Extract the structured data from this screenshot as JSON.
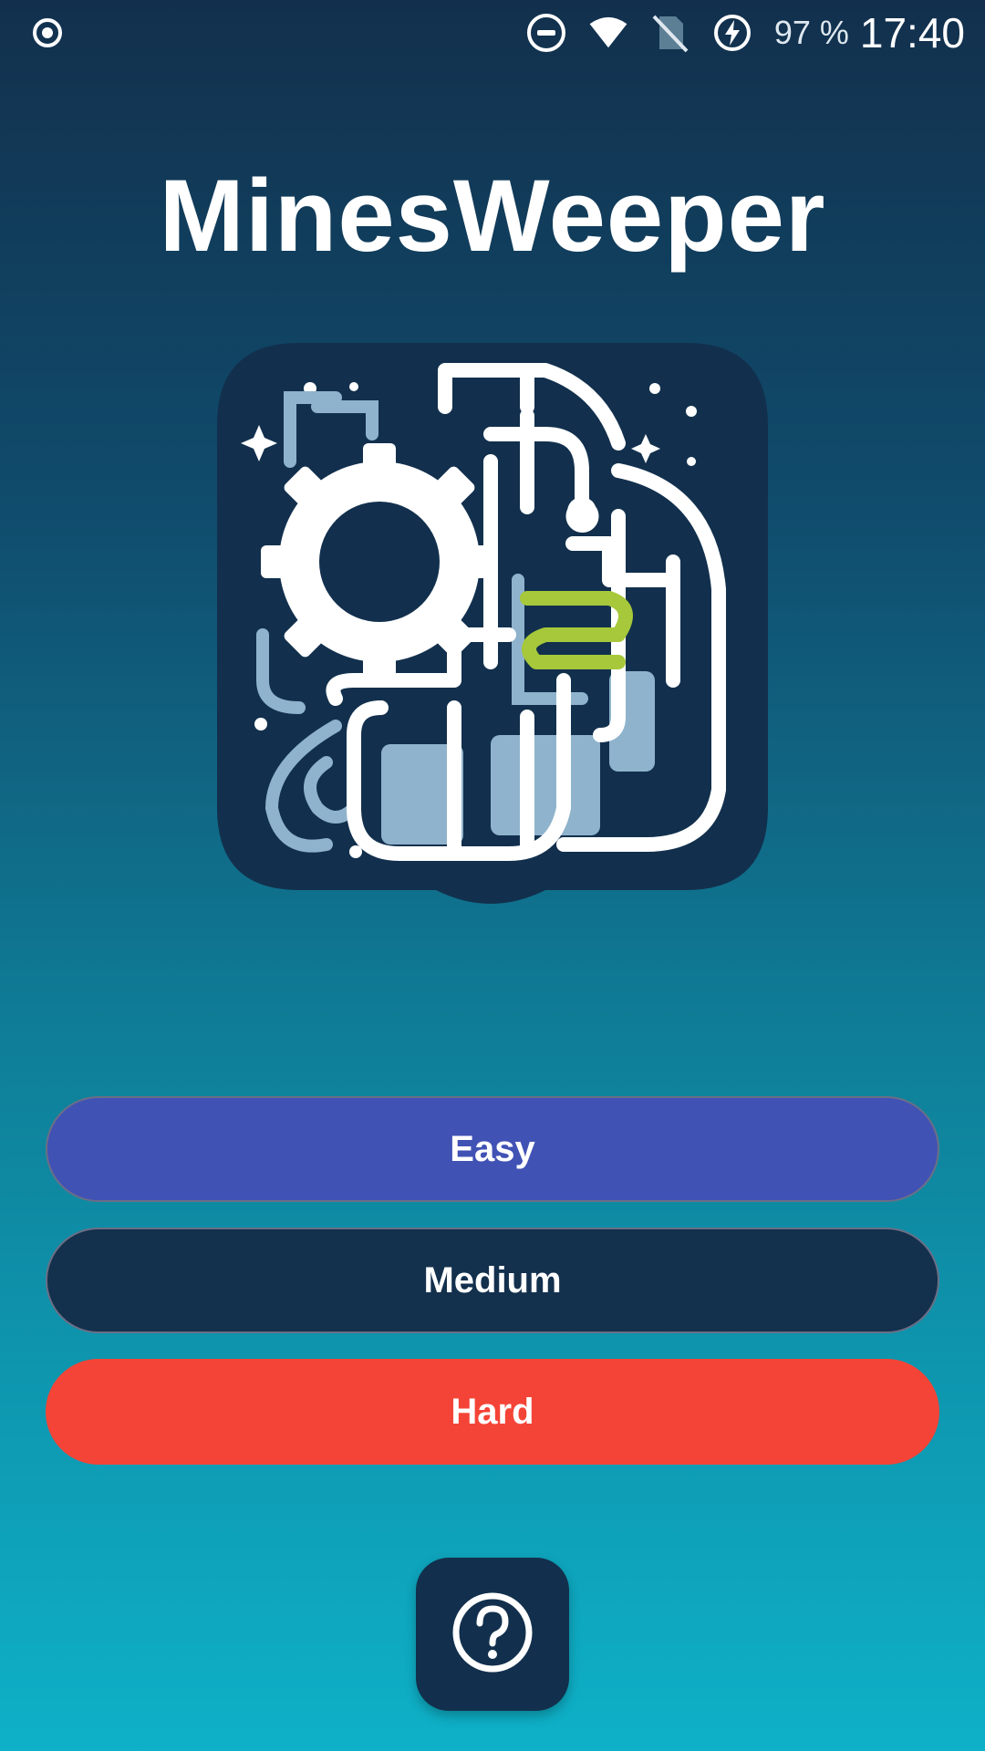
{
  "status_bar": {
    "battery": "97 %",
    "time": "17:40",
    "icons": [
      "record-icon",
      "do-not-disturb-icon",
      "wifi-icon",
      "no-sim-icon",
      "battery-charging-icon"
    ]
  },
  "app": {
    "title": "MinesWeeper",
    "logo": "brain-gear-logo-icon"
  },
  "difficulty": {
    "easy_label": "Easy",
    "medium_label": "Medium",
    "hard_label": "Hard"
  },
  "help": {
    "icon": "help-icon"
  },
  "colors": {
    "easy": "#4152b5",
    "medium": "#13304d",
    "hard": "#f44437",
    "fab": "#12304d",
    "logo_accent": "#a6c83a"
  }
}
